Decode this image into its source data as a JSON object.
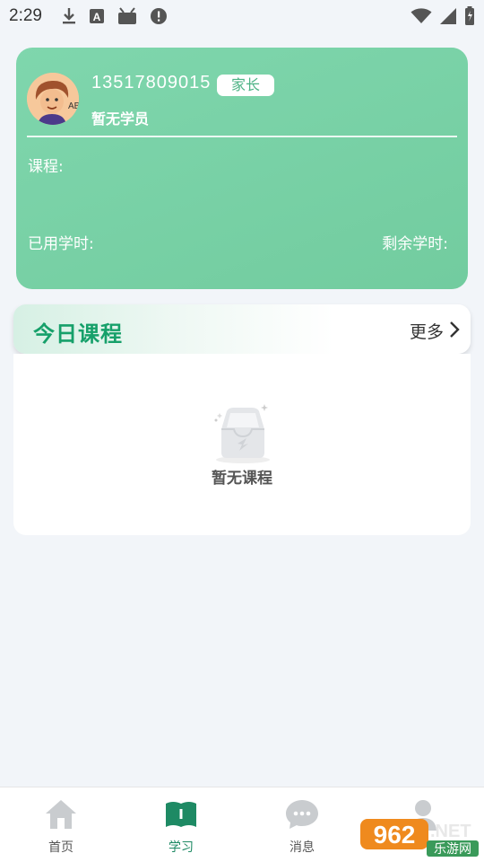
{
  "status_bar": {
    "time": "2:29",
    "icons": [
      "download-icon",
      "font-icon",
      "android-icon",
      "alert-icon"
    ],
    "right_icons": [
      "wifi-icon",
      "signal-icon",
      "battery-icon"
    ]
  },
  "profile": {
    "phone": "13517809015",
    "role": "家长",
    "student": "暂无学员",
    "course_label": "课程:",
    "used_hours_label": "已用学时:",
    "remaining_hours_label": "剩余学时:"
  },
  "today": {
    "title": "今日课程",
    "more": "更多",
    "empty_text": "暂无课程"
  },
  "nav": {
    "items": [
      {
        "label": "首页",
        "icon": "home-icon"
      },
      {
        "label": "学习",
        "icon": "book-icon"
      },
      {
        "label": "消息",
        "icon": "chat-icon"
      },
      {
        "label": "",
        "icon": "user-icon"
      }
    ],
    "active": "学习"
  },
  "watermark": {
    "number": "962",
    "domain": ".NET",
    "text": "乐游网"
  },
  "colors": {
    "card_gradient_start": "#7fd6ad",
    "accent_green": "#16a06a",
    "active_nav": "#1e8a64",
    "background": "#f2f5f9"
  }
}
